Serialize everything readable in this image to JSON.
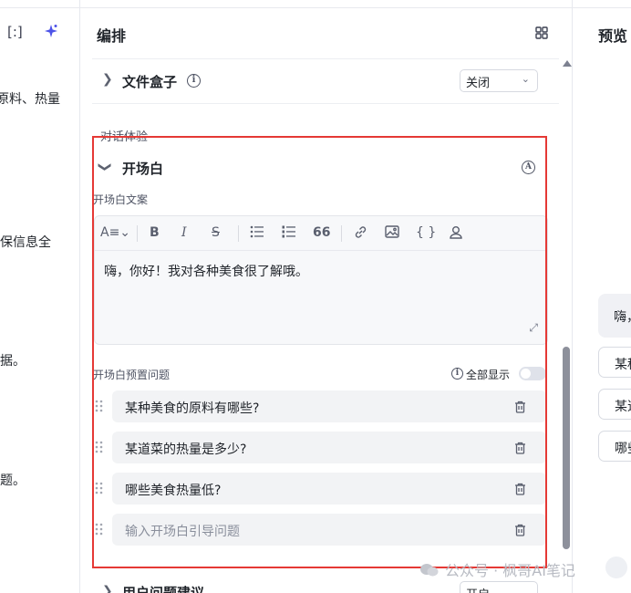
{
  "left_panel": {
    "icons": [
      "bracket-icon",
      "sparkle-icon"
    ],
    "fragments": [
      "原料、热量",
      "保信息全",
      "据。",
      "题。"
    ]
  },
  "mid_panel": {
    "title": "编排",
    "file_box": {
      "label": "文件盒子",
      "select_value": "关闭"
    },
    "section_dialog": "对话体验",
    "opening": {
      "title": "开场白",
      "copy_label": "开场白文案",
      "editor_text": "嗨，你好！我对各种美食很了解哦。",
      "toolbar": [
        "text-style",
        "bold",
        "italic",
        "strikethrough",
        "bullet-list",
        "numbered-list",
        "quote",
        "link",
        "image",
        "code-braces",
        "user"
      ],
      "quote_glyph": "66",
      "preset_label": "开场白预置问题",
      "show_all_label": "全部显示",
      "show_all_enabled": false,
      "questions": [
        "某种美食的原料有哪些?",
        "某道菜的热量是多少?",
        "哪些美食热量低?"
      ],
      "input_placeholder": "输入开场白引导问题"
    },
    "user_suggest": {
      "label": "用户问题建议",
      "select_value": "开启"
    }
  },
  "right_panel": {
    "title": "预览",
    "bubble": "嗨，",
    "questions": [
      "某种",
      "某道",
      "哪些"
    ]
  },
  "watermark": "公众号 · 枫哥AI笔记",
  "colors": {
    "accent": "#4d53e8",
    "highlight_box": "#e53935"
  }
}
